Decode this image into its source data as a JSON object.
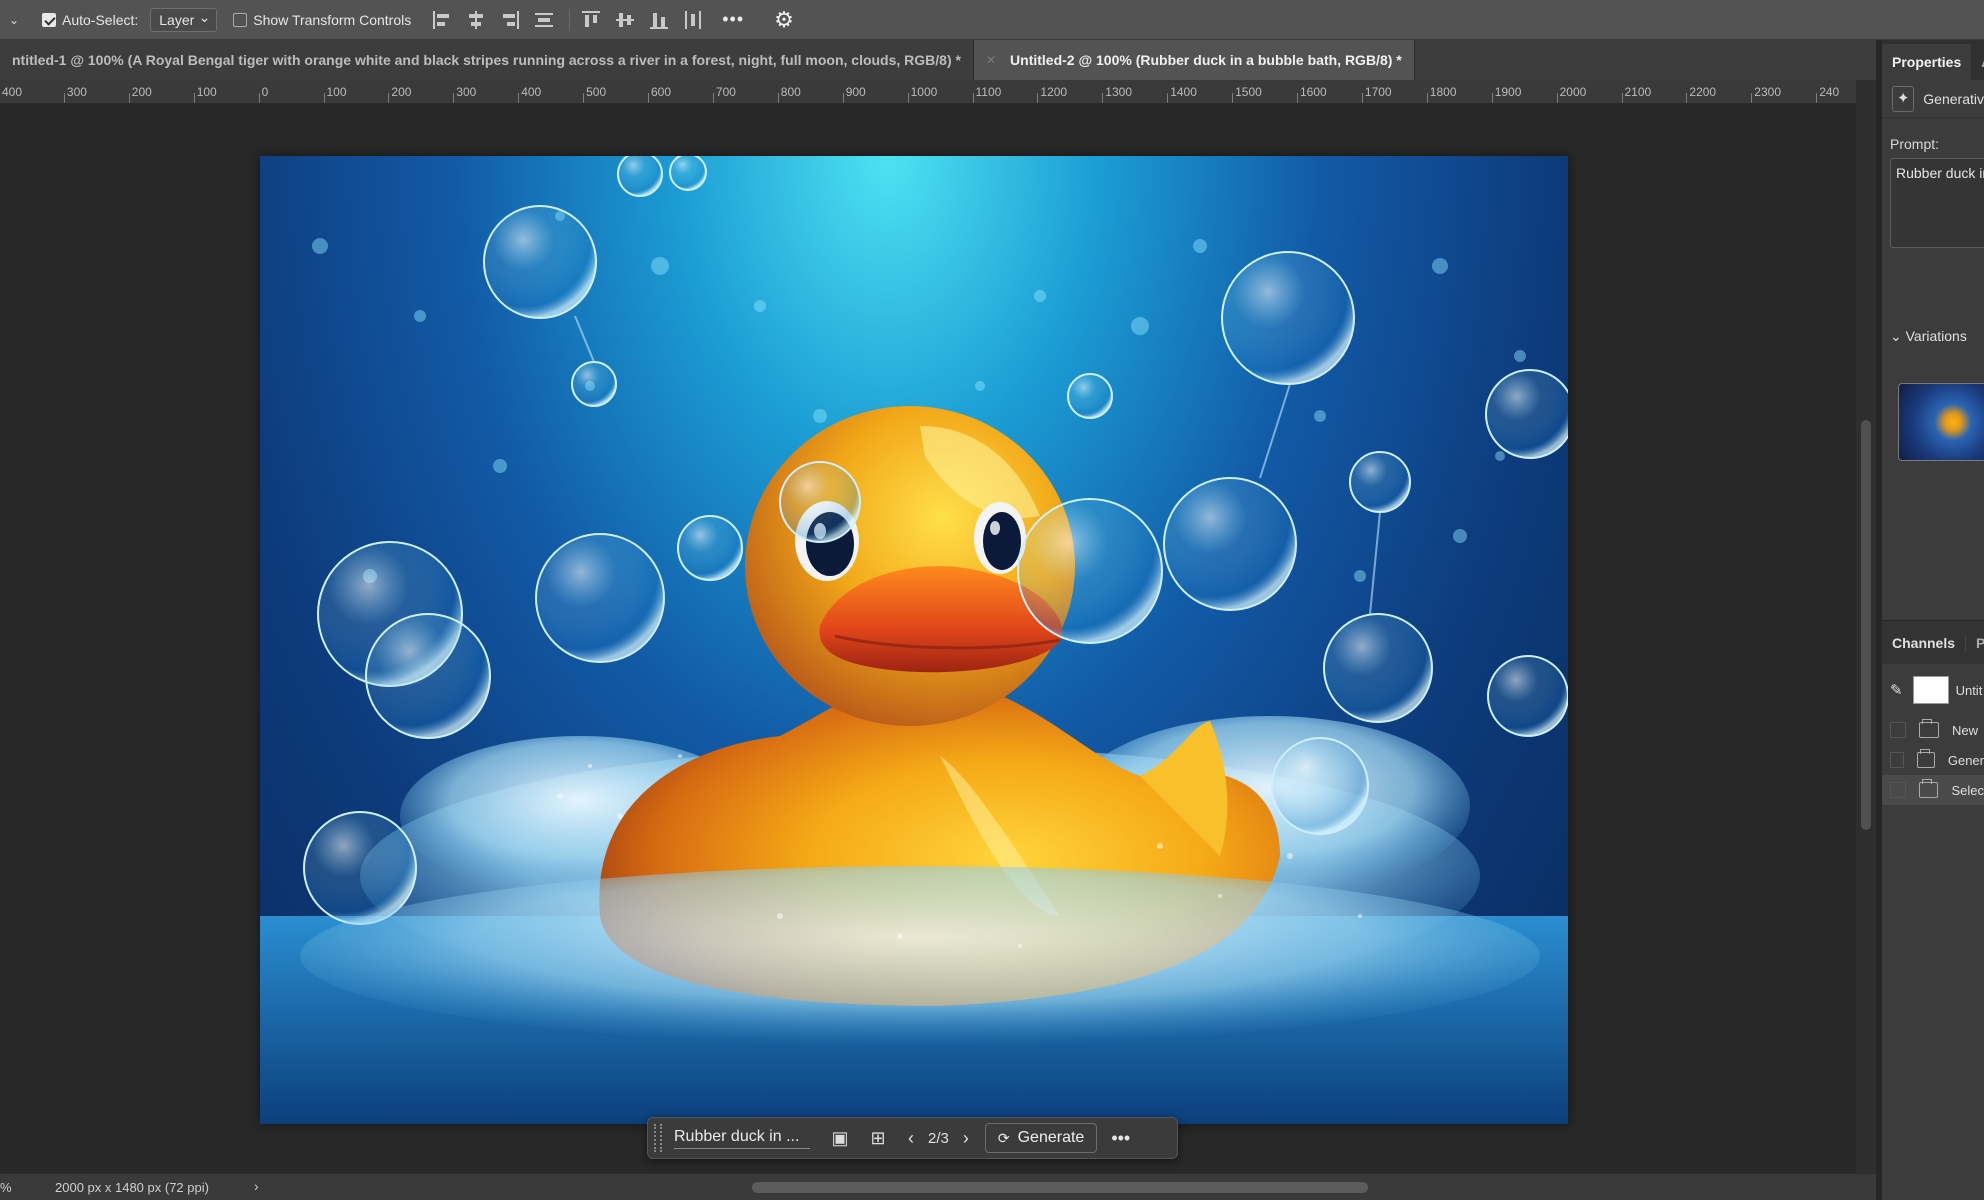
{
  "options_bar": {
    "auto_select_label": "Auto-Select:",
    "auto_select_checked": true,
    "layer_select_value": "Layer",
    "show_transform_label": "Show Transform Controls",
    "show_transform_checked": false,
    "more_label": "•••"
  },
  "tabs": [
    {
      "label": "ntitled-1 @ 100% (A Royal Bengal tiger with orange white and black stripes running across a river in a forest, night, full moon, clouds, RGB/8) *",
      "active": false
    },
    {
      "label": "Untitled-2 @ 100% (Rubber duck in a bubble bath, RGB/8) *",
      "active": true
    }
  ],
  "ruler": {
    "labels": [
      "400",
      "300",
      "200",
      "100",
      "0",
      "100",
      "200",
      "300",
      "400",
      "500",
      "600",
      "700",
      "800",
      "900",
      "1000",
      "1100",
      "1200",
      "1300",
      "1400",
      "1500",
      "1600",
      "1700",
      "1800",
      "1900",
      "2000",
      "2100",
      "2200",
      "2300",
      "240"
    ]
  },
  "taskbar": {
    "prompt": "Rubber duck in ...",
    "counter": "2/3",
    "generate_label": "Generate",
    "prev_icon": "‹",
    "next_icon": "›",
    "more_label": "•••"
  },
  "status": {
    "zoom": "%",
    "dimensions": "2000 px x 1480 px (72 ppi)",
    "arrow": "›"
  },
  "panel": {
    "tabs": [
      "Properties",
      "A"
    ],
    "layer_type": "Generativ",
    "prompt_label": "Prompt:",
    "prompt_text": "Rubber duck in",
    "variations_label": "Variations",
    "lower_tabs": [
      "Channels",
      "Pa"
    ],
    "layer_name": "Untit",
    "rows": [
      "New",
      "Gener",
      "Selec"
    ]
  },
  "colors": {
    "accent": "#4d9cf8",
    "duck": "#f5b417",
    "water": "#1b9dd4"
  },
  "icons": {
    "gear": "gear-icon",
    "generate": "generate-icon",
    "image": "image-icon",
    "select": "select-icon"
  }
}
